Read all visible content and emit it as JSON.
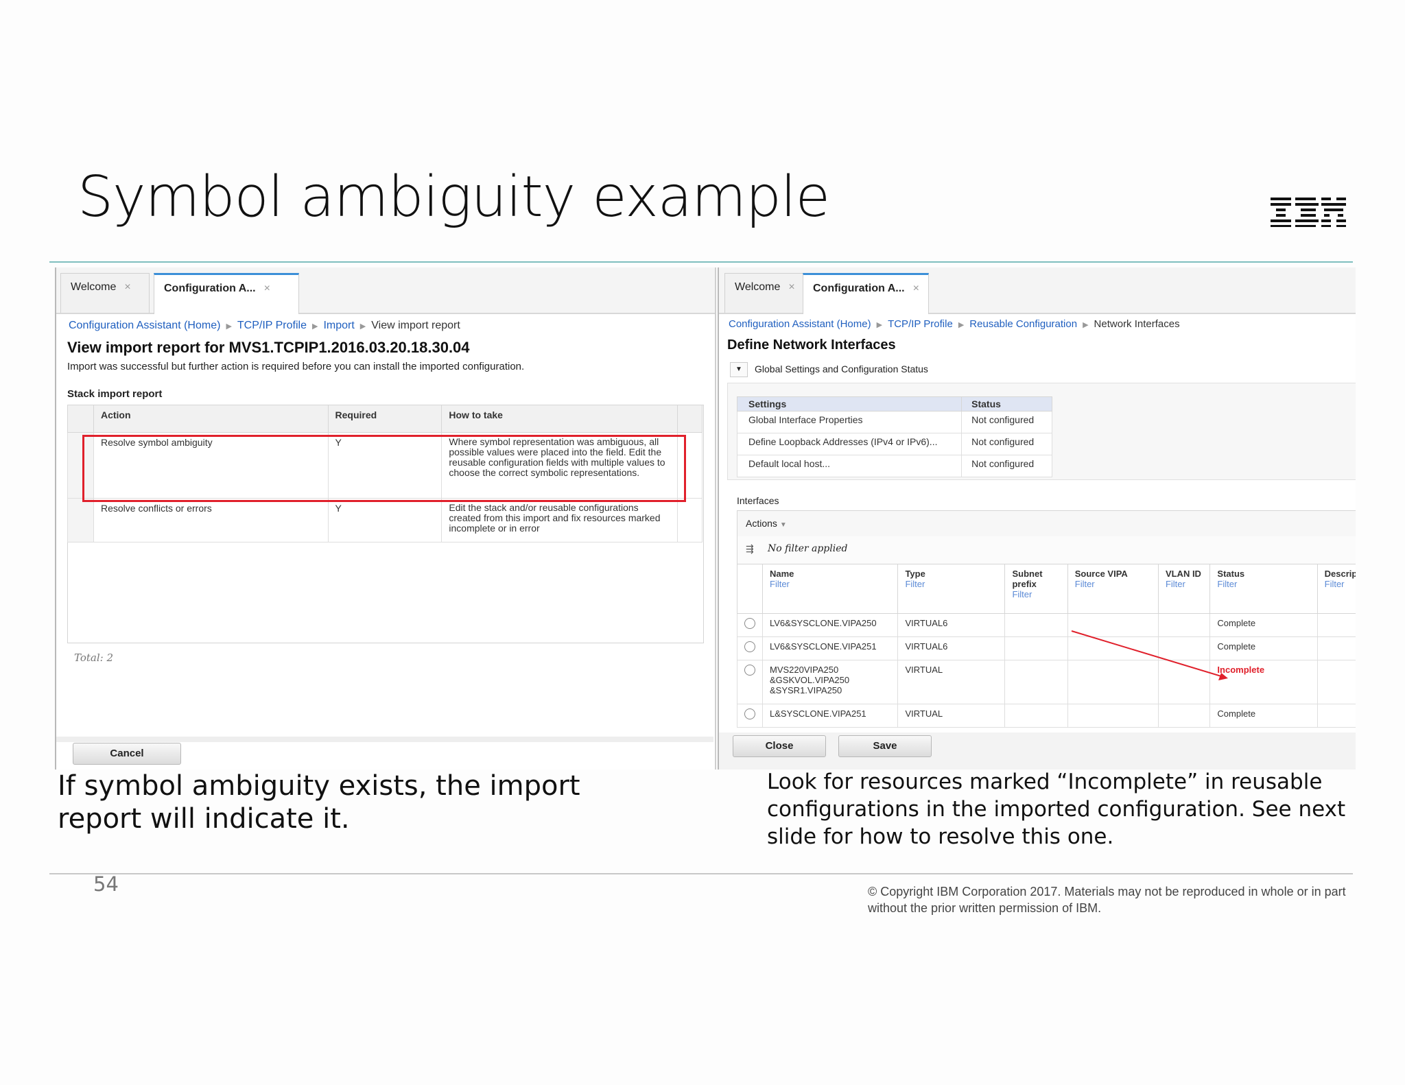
{
  "slide": {
    "title": "Symbol ambiguity example",
    "logo": "IBM",
    "page_number": "54",
    "copyright": "© Copyright IBM Corporation 2017.  Materials may not be reproduced in whole or in part without the prior written permission of IBM.",
    "caption_left": "If symbol ambiguity exists, the import report will indicate it.",
    "caption_right": "Look for resources marked “Incomplete” in reusable configurations in the imported configuration. See next slide for how to resolve this one.",
    "accent_color": "#7fbfbf"
  },
  "left": {
    "tabs": [
      {
        "label": "Welcome",
        "close": "×"
      },
      {
        "label": "Configuration A...",
        "close": "×"
      }
    ],
    "breadcrumb": [
      "Configuration Assistant (Home)",
      "TCP/IP Profile",
      "Import",
      "View import report"
    ],
    "heading": "View import report for MVS1.TCPIP1.2016.03.20.18.30.04",
    "message": "Import was successful but further action is required before you can install the imported configuration.",
    "section_title": "Stack import report",
    "columns": [
      "Action",
      "Required",
      "How to take"
    ],
    "rows": [
      {
        "action": "Resolve symbol ambiguity",
        "required": "Y",
        "how": "Where symbol representation was ambiguous, all possible values were placed into the field. Edit the reusable configuration fields with multiple values to choose the correct symbolic representations."
      },
      {
        "action": "Resolve conflicts or errors",
        "required": "Y",
        "how": "Edit the stack and/or reusable configurations created from this import and fix resources marked incomplete or in error"
      }
    ],
    "total": "Total: 2",
    "cancel_label": "Cancel",
    "highlight_color": "#e0202b"
  },
  "right": {
    "tabs": [
      {
        "label": "Welcome",
        "close": "×"
      },
      {
        "label": "Configuration A...",
        "close": "×"
      }
    ],
    "breadcrumb": [
      "Configuration Assistant (Home)",
      "TCP/IP Profile",
      "Reusable Configuration",
      "Network Interfaces"
    ],
    "heading": "Define Network Interfaces",
    "section_toggle": "Global Settings and Configuration Status",
    "settings_columns": [
      "Settings",
      "Status"
    ],
    "settings_rows": [
      {
        "setting": "Global Interface Properties",
        "status": "Not configured"
      },
      {
        "setting": "Define Loopback Addresses (IPv4 or IPv6)...",
        "status": "Not configured"
      },
      {
        "setting": "Default local host...",
        "status": "Not configured"
      }
    ],
    "interfaces_label": "Interfaces",
    "actions_label": "Actions",
    "filter_text": "No filter applied",
    "columns": [
      "Name",
      "Type",
      "Subnet prefix",
      "Source VIPA",
      "VLAN ID",
      "Status",
      "Descrip"
    ],
    "filter_label": "Filter",
    "rows": [
      {
        "name": "LV6&SYSCLONE.VIPA250",
        "type": "VIRTUAL6",
        "status": "Complete"
      },
      {
        "name": "LV6&SYSCLONE.VIPA251",
        "type": "VIRTUAL6",
        "status": "Complete"
      },
      {
        "name": "MVS220VIPA250 &GSKVOL.VIPA250 &SYSR1.VIPA250",
        "type": "VIRTUAL",
        "status": "Incomplete"
      },
      {
        "name": "L&SYSCLONE.VIPA251",
        "type": "VIRTUAL",
        "status": "Complete"
      }
    ],
    "close_label": "Close",
    "save_label": "Save",
    "incomplete_color": "#e0202b"
  }
}
